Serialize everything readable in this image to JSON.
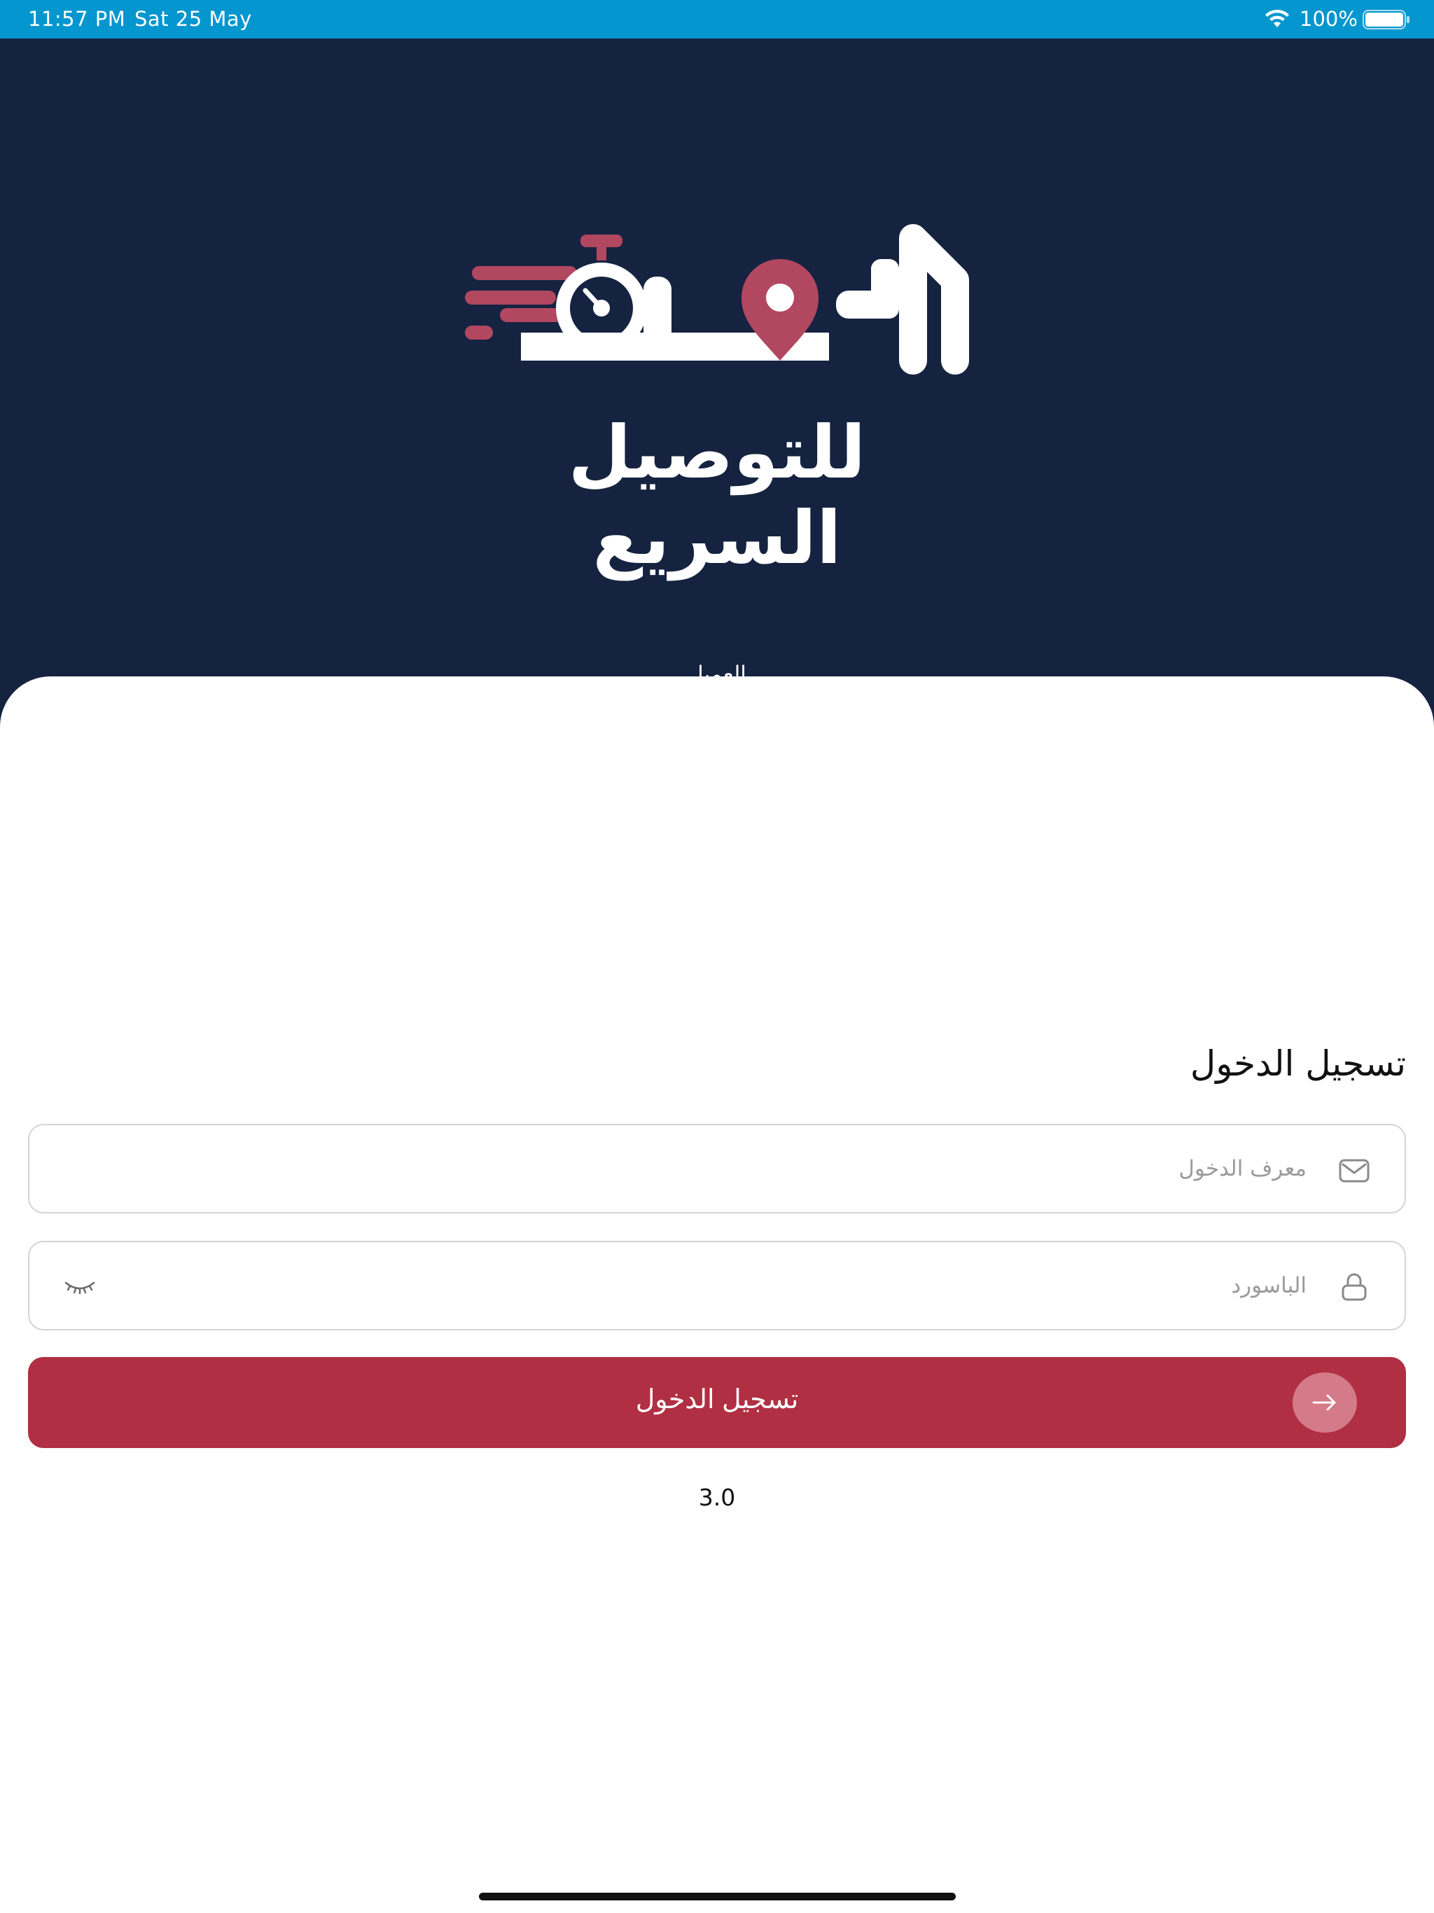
{
  "status_bar": {
    "time": "11:57 PM",
    "date": "Sat 25 May",
    "battery_percent": "100%",
    "battery_level": 1.0,
    "wifi_icon": "wifi-icon",
    "battery_icon": "battery-icon"
  },
  "header": {
    "logo_name": "الامين",
    "logo_tagline": "للتوصيل السريع",
    "role_label": "العميل",
    "colors": {
      "background": "#152340",
      "logo_accent": "#b24760",
      "logo_white": "#ffffff"
    }
  },
  "form": {
    "title": "تسجيل الدخول",
    "login_id": {
      "placeholder": "معرف الدخول",
      "value": "",
      "icon": "mail-icon"
    },
    "password": {
      "placeholder": "الباسورد",
      "value": "",
      "icon": "lock-icon",
      "toggle_icon": "eye-closed-icon"
    },
    "submit_label": "تسجيل الدخول",
    "submit_icon": "arrow-right-icon",
    "colors": {
      "button": "#b02f43",
      "button_icon_circle": "#d47a88"
    }
  },
  "version": "3.0"
}
